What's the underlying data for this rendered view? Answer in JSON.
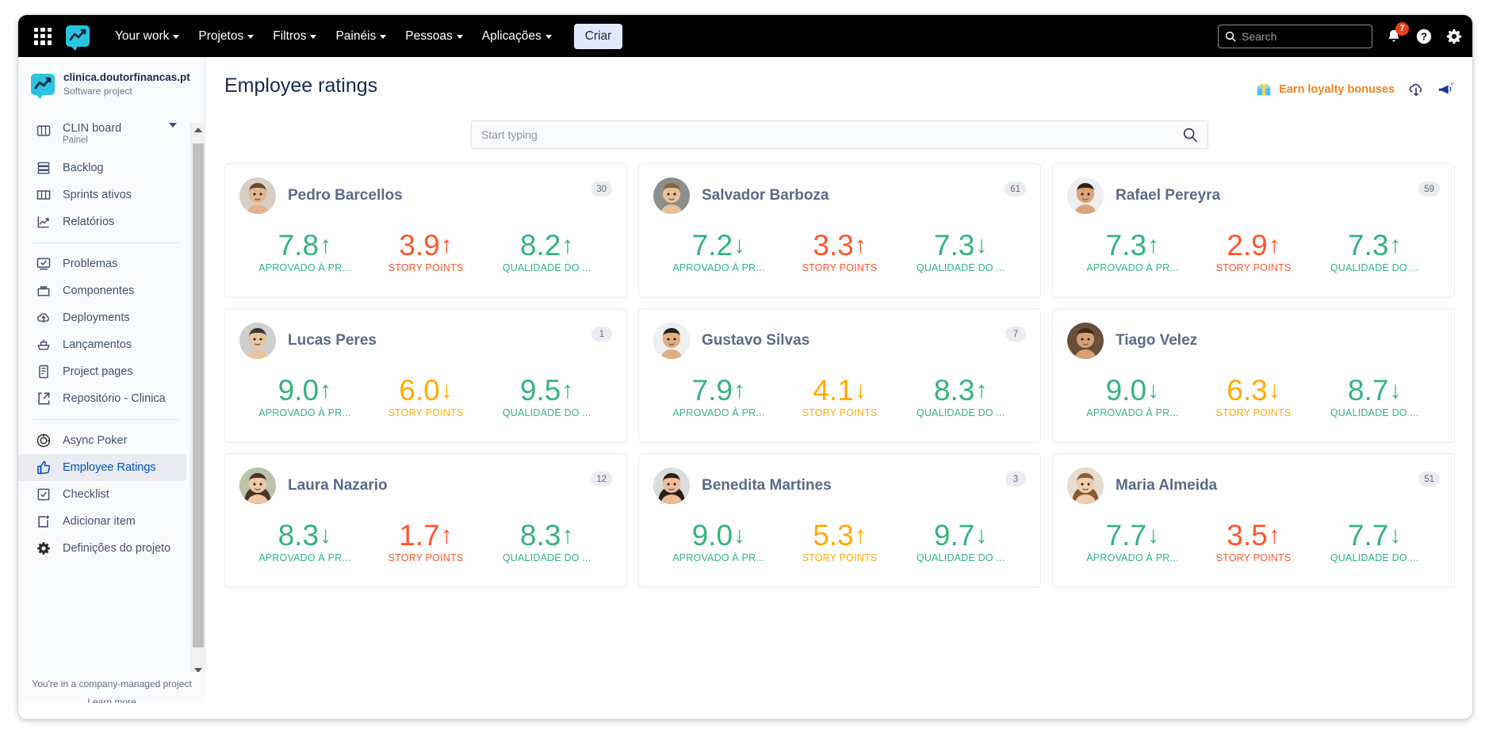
{
  "colors": {
    "nav_bg": "#000000",
    "accent_blue": "#0052cc",
    "brand_teal": "#2bc4e0",
    "green": "#36b37e",
    "amber": "#ffab00",
    "red": "#ff5630",
    "orange_link": "#f5821f",
    "badge_red": "#e8401f"
  },
  "topnav": {
    "apps_icon": "apps-grid-icon",
    "logo_icon": "jira-logo-icon",
    "items": [
      {
        "label": "Your work",
        "has_caret": true
      },
      {
        "label": "Projetos",
        "has_caret": true
      },
      {
        "label": "Filtros",
        "has_caret": true
      },
      {
        "label": "Painéis",
        "has_caret": true
      },
      {
        "label": "Pessoas",
        "has_caret": true
      },
      {
        "label": "Aplicações",
        "has_caret": true
      }
    ],
    "create_label": "Criar",
    "search_placeholder": "Search",
    "notification_count": "7",
    "help_icon": "help-circle-icon",
    "settings_icon": "gear-icon"
  },
  "sidebar": {
    "project_name": "clinica.doutorfinancas.pt",
    "project_type": "Software project",
    "board": {
      "label": "CLIN board",
      "sublabel": "Painel",
      "icon": "board-icon"
    },
    "group1": [
      {
        "label": "Backlog",
        "icon": "backlog-icon"
      },
      {
        "label": "Sprints ativos",
        "icon": "columns-icon"
      },
      {
        "label": "Relatórios",
        "icon": "chart-icon"
      }
    ],
    "group2": [
      {
        "label": "Problemas",
        "icon": "issues-icon"
      },
      {
        "label": "Componentes",
        "icon": "components-icon"
      },
      {
        "label": "Deployments",
        "icon": "cloud-upload-icon"
      },
      {
        "label": "Lançamentos",
        "icon": "ship-icon"
      },
      {
        "label": "Project pages",
        "icon": "page-icon"
      },
      {
        "label": "Repositório - Clinica",
        "icon": "external-link-icon"
      }
    ],
    "group3": [
      {
        "label": "Async Poker",
        "icon": "poker-icon",
        "selected": false
      },
      {
        "label": "Employee Ratings",
        "icon": "thumbs-up-icon",
        "selected": true
      },
      {
        "label": "Checklist",
        "icon": "checkbox-icon",
        "selected": false
      },
      {
        "label": "Adicionar item",
        "icon": "add-item-icon",
        "selected": false
      },
      {
        "label": "Definições do projeto",
        "icon": "gear-icon",
        "selected": false
      }
    ],
    "footer_note": "You're in a company-managed project",
    "footer_link": "Learn more"
  },
  "main": {
    "title": "Employee ratings",
    "loyalty_icon": "gift-icon",
    "loyalty_label": "Earn loyalty bonuses",
    "download_icon": "cloud-download-icon",
    "megaphone_icon": "megaphone-icon",
    "search_placeholder": "Start typing",
    "search_icon": "search-icon"
  },
  "metric_labels": {
    "approved": "APROVADO À PR...",
    "story_points": "STORY POINTS",
    "quality": "QUALIDADE DO ..."
  },
  "employees": [
    {
      "name": "Pedro Barcellos",
      "count": "30",
      "avatar": "male-1",
      "metrics": [
        {
          "value": "7.8",
          "arrow": "↑",
          "label": "APROVADO À PR...",
          "color": "#36b37e"
        },
        {
          "value": "3.9",
          "arrow": "↑",
          "label": "STORY POINTS",
          "color": "#ff5630"
        },
        {
          "value": "8.2",
          "arrow": "↑",
          "label": "QUALIDADE DO ...",
          "color": "#36b37e"
        }
      ]
    },
    {
      "name": "Salvador Barboza",
      "count": "61",
      "avatar": "male-2",
      "metrics": [
        {
          "value": "7.2",
          "arrow": "↓",
          "label": "APROVADO À PR...",
          "color": "#36b37e"
        },
        {
          "value": "3.3",
          "arrow": "↑",
          "label": "STORY POINTS",
          "color": "#ff5630"
        },
        {
          "value": "7.3",
          "arrow": "↓",
          "label": "QUALIDADE DO ...",
          "color": "#36b37e"
        }
      ]
    },
    {
      "name": "Rafael Pereyra",
      "count": "59",
      "avatar": "male-3",
      "metrics": [
        {
          "value": "7.3",
          "arrow": "↑",
          "label": "APROVADO À PR...",
          "color": "#36b37e"
        },
        {
          "value": "2.9",
          "arrow": "↑",
          "label": "STORY POINTS",
          "color": "#ff5630"
        },
        {
          "value": "7.3",
          "arrow": "↑",
          "label": "QUALIDADE DO ...",
          "color": "#36b37e"
        }
      ]
    },
    {
      "name": "Lucas Peres",
      "count": "1",
      "avatar": "male-4",
      "metrics": [
        {
          "value": "9.0",
          "arrow": "↑",
          "label": "APROVADO À PR...",
          "color": "#36b37e"
        },
        {
          "value": "6.0",
          "arrow": "↓",
          "label": "STORY POINTS",
          "color": "#ffab00"
        },
        {
          "value": "9.5",
          "arrow": "↑",
          "label": "QUALIDADE DO ...",
          "color": "#36b37e"
        }
      ]
    },
    {
      "name": "Gustavo Silvas",
      "count": "7",
      "avatar": "male-5",
      "metrics": [
        {
          "value": "7.9",
          "arrow": "↑",
          "label": "APROVADO À PR...",
          "color": "#36b37e"
        },
        {
          "value": "4.1",
          "arrow": "↓",
          "label": "STORY POINTS",
          "color": "#ffab00"
        },
        {
          "value": "8.3",
          "arrow": "↑",
          "label": "QUALIDADE DO ...",
          "color": "#36b37e"
        }
      ]
    },
    {
      "name": "Tiago Velez",
      "count": "",
      "avatar": "male-6",
      "metrics": [
        {
          "value": "9.0",
          "arrow": "↓",
          "label": "APROVADO À PR...",
          "color": "#36b37e"
        },
        {
          "value": "6.3",
          "arrow": "↓",
          "label": "STORY POINTS",
          "color": "#ffab00"
        },
        {
          "value": "8.7",
          "arrow": "↓",
          "label": "QUALIDADE DO ...",
          "color": "#36b37e"
        }
      ]
    },
    {
      "name": "Laura Nazario",
      "count": "12",
      "avatar": "female-1",
      "metrics": [
        {
          "value": "8.3",
          "arrow": "↓",
          "label": "APROVADO À PR...",
          "color": "#36b37e"
        },
        {
          "value": "1.7",
          "arrow": "↑",
          "label": "STORY POINTS",
          "color": "#ff5630"
        },
        {
          "value": "8.3",
          "arrow": "↑",
          "label": "QUALIDADE DO ...",
          "color": "#36b37e"
        }
      ]
    },
    {
      "name": "Benedita Martines",
      "count": "3",
      "avatar": "female-2",
      "metrics": [
        {
          "value": "9.0",
          "arrow": "↓",
          "label": "APROVADO À PR...",
          "color": "#36b37e"
        },
        {
          "value": "5.3",
          "arrow": "↑",
          "label": "STORY POINTS",
          "color": "#ffab00"
        },
        {
          "value": "9.7",
          "arrow": "↓",
          "label": "QUALIDADE DO ...",
          "color": "#36b37e"
        }
      ]
    },
    {
      "name": "Maria Almeida",
      "count": "51",
      "avatar": "female-3",
      "metrics": [
        {
          "value": "7.7",
          "arrow": "↓",
          "label": "APROVADO À PR...",
          "color": "#36b37e"
        },
        {
          "value": "3.5",
          "arrow": "↑",
          "label": "STORY POINTS",
          "color": "#ff5630"
        },
        {
          "value": "7.7",
          "arrow": "↓",
          "label": "QUALIDADE DO ...",
          "color": "#36b37e"
        }
      ]
    }
  ]
}
